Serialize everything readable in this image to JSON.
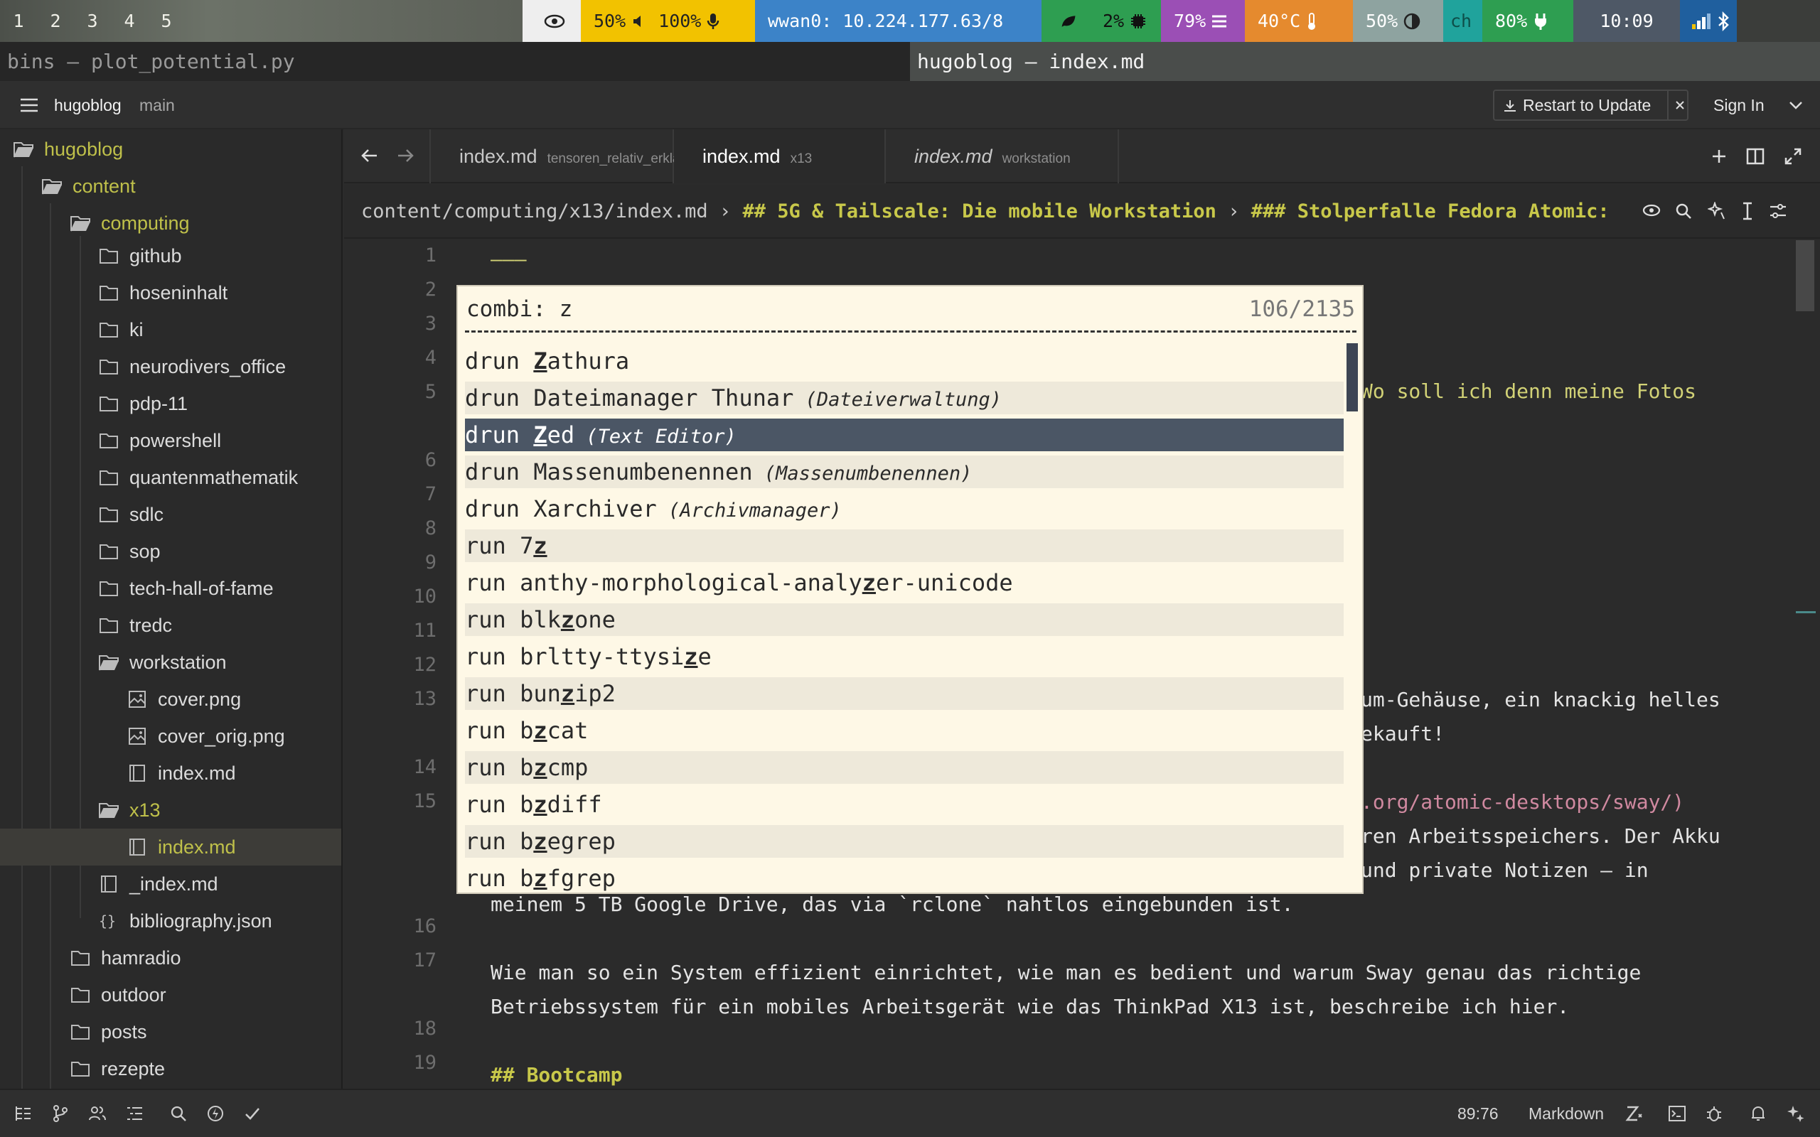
{
  "statusbar": {
    "workspaces": [
      "1",
      "2",
      "3",
      "4",
      "5"
    ],
    "volume": "50%",
    "mic": "100%",
    "network": "wwan0: 10.224.177.63/8",
    "cpu": "2%",
    "memory": "79%",
    "temp": "40°C",
    "brightness": "50%",
    "keyboard": "ch",
    "battery": "80%",
    "clock": "10:09",
    "colors": {
      "yellow": "#f2c200",
      "blue": "#3c83c8",
      "green": "#2e9e51",
      "purple": "#9b4fb5",
      "orange": "#e58a2e",
      "gray": "#8ea3a0",
      "teal": "#20a39c",
      "navy": "#1f5f9e"
    }
  },
  "windows": {
    "left_title": "bins – plot_potential.py",
    "right_title": "hugoblog – index.md"
  },
  "header": {
    "project": "hugoblog",
    "branch": "main",
    "restart_label": "Restart to Update",
    "sign_in": "Sign In"
  },
  "sidebar": {
    "root": "hugoblog",
    "items": [
      {
        "label": "content",
        "type": "folder-open"
      },
      {
        "label": "computing",
        "type": "folder-open"
      },
      {
        "label": "github",
        "type": "folder"
      },
      {
        "label": "hoseninhalt",
        "type": "folder"
      },
      {
        "label": "ki",
        "type": "folder"
      },
      {
        "label": "neurodivers_office",
        "type": "folder"
      },
      {
        "label": "pdp-11",
        "type": "folder"
      },
      {
        "label": "powershell",
        "type": "folder"
      },
      {
        "label": "quantenmathematik",
        "type": "folder"
      },
      {
        "label": "sdlc",
        "type": "folder"
      },
      {
        "label": "sop",
        "type": "folder"
      },
      {
        "label": "tech-hall-of-fame",
        "type": "folder"
      },
      {
        "label": "tredc",
        "type": "folder"
      },
      {
        "label": "workstation",
        "type": "folder-open"
      },
      {
        "label": "cover.png",
        "type": "image"
      },
      {
        "label": "cover_orig.png",
        "type": "image"
      },
      {
        "label": "index.md",
        "type": "book"
      },
      {
        "label": "x13",
        "type": "folder-open"
      },
      {
        "label": "index.md",
        "type": "book"
      },
      {
        "label": "_index.md",
        "type": "book"
      },
      {
        "label": "bibliography.json",
        "type": "json"
      },
      {
        "label": "hamradio",
        "type": "folder"
      },
      {
        "label": "outdoor",
        "type": "folder"
      },
      {
        "label": "posts",
        "type": "folder"
      },
      {
        "label": "rezepte",
        "type": "folder"
      }
    ]
  },
  "tabs": [
    {
      "label": "index.md",
      "hint": "tensoren_relativ_erklaer..."
    },
    {
      "label": "index.md",
      "hint": "x13"
    },
    {
      "label": "index.md",
      "hint": "workstation"
    }
  ],
  "breadcrumb": {
    "path": "content/computing/x13/index.md",
    "h2": "## 5G & Tailscale: Die mobile Workstation",
    "h3": "### Stolperfalle Fedora Atomic:"
  },
  "editor": {
    "line_numbers": [
      "1",
      "2",
      "3",
      "4",
      "5",
      "6",
      "7",
      "8",
      "9",
      "10",
      "11",
      "12",
      "13",
      "14",
      "15",
      "16",
      "17",
      "18",
      "19"
    ],
    "visible_lines": {
      "l1": "———",
      "l5": "Wo soll ich denn meine Fotos",
      "l13a": "um-Gehäuse, ein knackig helles",
      "l13b": "ekauft!",
      "l15a": ".org/atomic-desktops/sway/)",
      "l15b": "ren Arbeitsspeichers. Der Akku",
      "l15c": "und private Notizen – in",
      "l15d": "meinem 5 TB Google Drive, das via `rclone` nahtlos eingebunden ist.",
      "l17a": "Wie man so ein System effizient einrichtet, wie man es bedient und warum Sway genau das richtige",
      "l17b": "Betriebssystem für ein mobiles Arbeitsgerät wie das ThinkPad X13 ist, beschreibe ich hier.",
      "l19": "## Bootcamp"
    }
  },
  "bottom": {
    "cursor": "89:76",
    "language": "Markdown"
  },
  "rofi": {
    "prompt": "combi: z",
    "count": "106/2135",
    "items": [
      {
        "mode": "drun",
        "name": "Zathura",
        "desc": ""
      },
      {
        "mode": "drun",
        "name": "Dateimanager Thunar",
        "desc": "(Dateiverwaltung)"
      },
      {
        "mode": "drun",
        "name": "Zed",
        "desc": "(Text Editor)"
      },
      {
        "mode": "drun",
        "name": "Massenumbenennen",
        "desc": "(Massenumbenennen)"
      },
      {
        "mode": "drun",
        "name": "Xarchiver",
        "desc": "(Archivmanager)"
      },
      {
        "mode": "run",
        "name": "7z",
        "desc": ""
      },
      {
        "mode": "run",
        "name": "anthy-morphological-analyzer-unicode",
        "desc": ""
      },
      {
        "mode": "run",
        "name": "blkzone",
        "desc": ""
      },
      {
        "mode": "run",
        "name": "brltty-ttysize",
        "desc": ""
      },
      {
        "mode": "run",
        "name": "bunzip2",
        "desc": ""
      },
      {
        "mode": "run",
        "name": "bzcat",
        "desc": ""
      },
      {
        "mode": "run",
        "name": "bzcmp",
        "desc": ""
      },
      {
        "mode": "run",
        "name": "bzdiff",
        "desc": ""
      },
      {
        "mode": "run",
        "name": "bzegrep",
        "desc": ""
      },
      {
        "mode": "run",
        "name": "bzfgrep",
        "desc": ""
      }
    ],
    "selected_index": 2
  }
}
